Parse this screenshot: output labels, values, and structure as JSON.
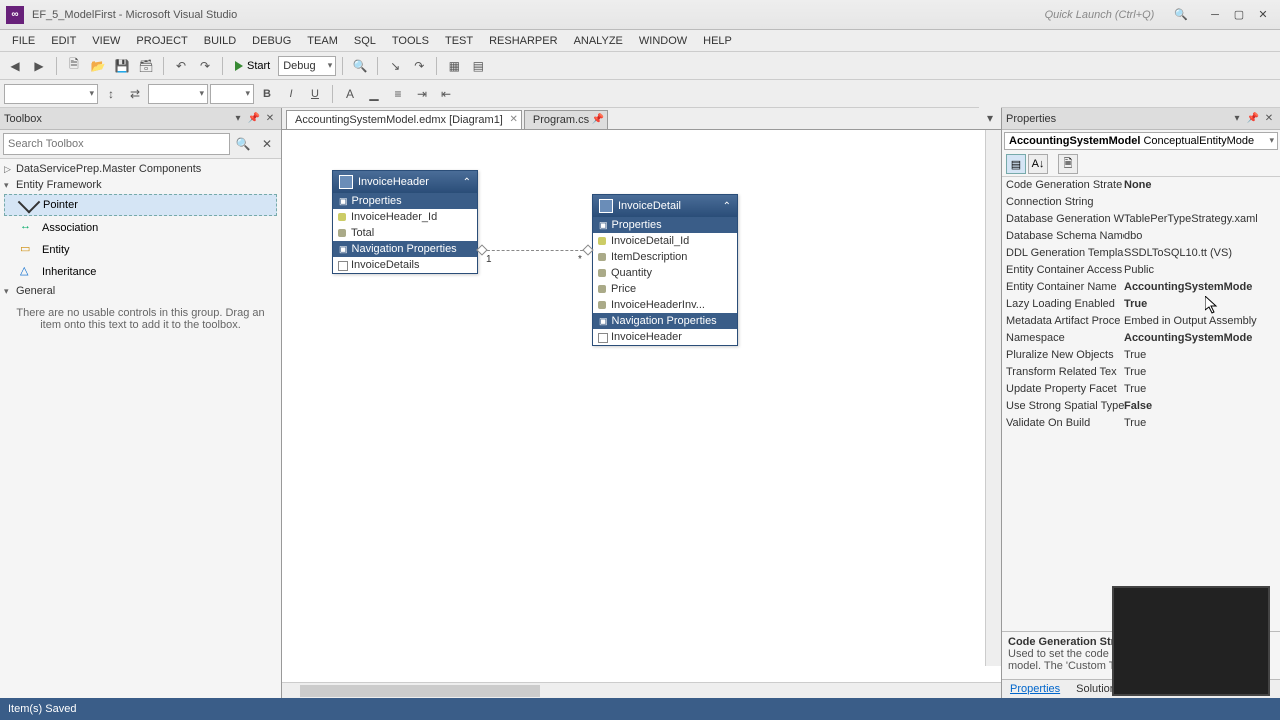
{
  "title": "EF_5_ModelFirst - Microsoft Visual Studio",
  "quick_launch": "Quick Launch (Ctrl+Q)",
  "menu": [
    "FILE",
    "EDIT",
    "VIEW",
    "PROJECT",
    "BUILD",
    "DEBUG",
    "TEAM",
    "SQL",
    "TOOLS",
    "TEST",
    "RESHARPER",
    "ANALYZE",
    "WINDOW",
    "HELP"
  ],
  "toolbar": {
    "start": "Start",
    "config": "Debug"
  },
  "toolbox": {
    "title": "Toolbox",
    "search_placeholder": "Search Toolbox",
    "groups": {
      "dsp": "DataServicePrep.Master Components",
      "ef": "Entity Framework",
      "gen": "General"
    },
    "items": {
      "pointer": "Pointer",
      "assoc": "Association",
      "entity": "Entity",
      "inherit": "Inheritance"
    },
    "hint": "There are no usable controls in this group. Drag an item onto this text to add it to the toolbox."
  },
  "tabs": {
    "active": "AccountingSystemModel.edmx [Diagram1]",
    "other": "Program.cs"
  },
  "entities": {
    "hdr": {
      "name": "InvoiceHeader",
      "sect_p": "Properties",
      "sect_n": "Navigation Properties",
      "props": [
        "InvoiceHeader_Id",
        "Total"
      ],
      "navs": [
        "InvoiceDetails"
      ]
    },
    "det": {
      "name": "InvoiceDetail",
      "sect_p": "Properties",
      "sect_n": "Navigation Properties",
      "props": [
        "InvoiceDetail_Id",
        "ItemDescription",
        "Quantity",
        "Price",
        "InvoiceHeaderInv..."
      ],
      "navs": [
        "InvoiceHeader"
      ]
    },
    "rel": {
      "left": "1",
      "right": "*"
    }
  },
  "properties": {
    "title": "Properties",
    "obj_name": "AccountingSystemModel",
    "obj_type": "ConceptualEntityMode",
    "rows": [
      {
        "k": "Code Generation Strate",
        "v": "None",
        "b": true
      },
      {
        "k": "Connection String",
        "v": ""
      },
      {
        "k": "Database Generation W",
        "v": "TablePerTypeStrategy.xaml"
      },
      {
        "k": "Database Schema Name",
        "v": "dbo"
      },
      {
        "k": "DDL Generation Templa",
        "v": "SSDLToSQL10.tt (VS)"
      },
      {
        "k": "Entity Container Access",
        "v": "Public"
      },
      {
        "k": "Entity Container Name",
        "v": "AccountingSystemMode",
        "b": true
      },
      {
        "k": "Lazy Loading Enabled",
        "v": "True",
        "b": true
      },
      {
        "k": "Metadata Artifact Proce",
        "v": "Embed in Output Assembly"
      },
      {
        "k": "Namespace",
        "v": "AccountingSystemMode",
        "b": true
      },
      {
        "k": "Pluralize New Objects",
        "v": "True"
      },
      {
        "k": "Transform Related Tex",
        "v": "True"
      },
      {
        "k": "Update Property Facet",
        "v": "True"
      },
      {
        "k": "Use Strong Spatial Type",
        "v": "False",
        "b": true
      },
      {
        "k": "Validate On Build",
        "v": "True"
      }
    ],
    "desc_title": "Code Generation Str",
    "desc_body": "Used to set the code ge\nmodel. The 'Custom Too",
    "btabs": {
      "props": "Properties",
      "sol": "Solution E..."
    }
  },
  "status": "Item(s) Saved"
}
